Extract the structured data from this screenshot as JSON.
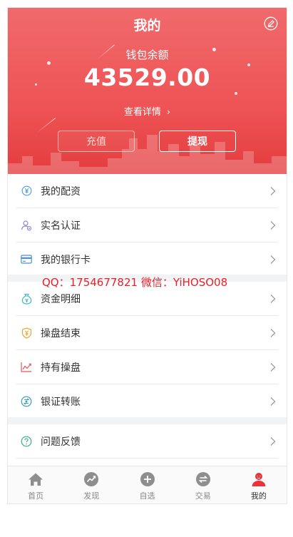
{
  "header": {
    "title": "我的",
    "wallet_label": "钱包余额",
    "balance": "43529.00",
    "detail_link": "查看详情",
    "recharge_label": "充值",
    "withdraw_label": "提现"
  },
  "menu_group_1": [
    {
      "label": "我的配资",
      "icon": "yuan-coin-icon"
    },
    {
      "label": "实名认证",
      "icon": "user-verify-icon"
    },
    {
      "label": "我的银行卡",
      "icon": "bank-card-icon"
    }
  ],
  "menu_group_2": [
    {
      "label": "资金明细",
      "icon": "money-bag-icon"
    },
    {
      "label": "操盘结束",
      "icon": "yuan-shield-icon"
    },
    {
      "label": "持有操盘",
      "icon": "trend-chart-icon"
    },
    {
      "label": "银证转账",
      "icon": "transfer-icon"
    }
  ],
  "menu_group_3": [
    {
      "label": "问题反馈",
      "icon": "question-icon"
    }
  ],
  "watermark": "QQ：1754677821 微信：YiHOSO08",
  "tabbar": [
    {
      "label": "首页",
      "icon": "home-icon"
    },
    {
      "label": "发现",
      "icon": "discover-icon"
    },
    {
      "label": "自选",
      "icon": "plus-circle-icon"
    },
    {
      "label": "交易",
      "icon": "exchange-icon"
    },
    {
      "label": "我的",
      "icon": "user-icon",
      "active": true
    }
  ],
  "colors": {
    "brand_red": "#ee5355",
    "watermark_red": "#e8202a",
    "text": "#333333"
  }
}
